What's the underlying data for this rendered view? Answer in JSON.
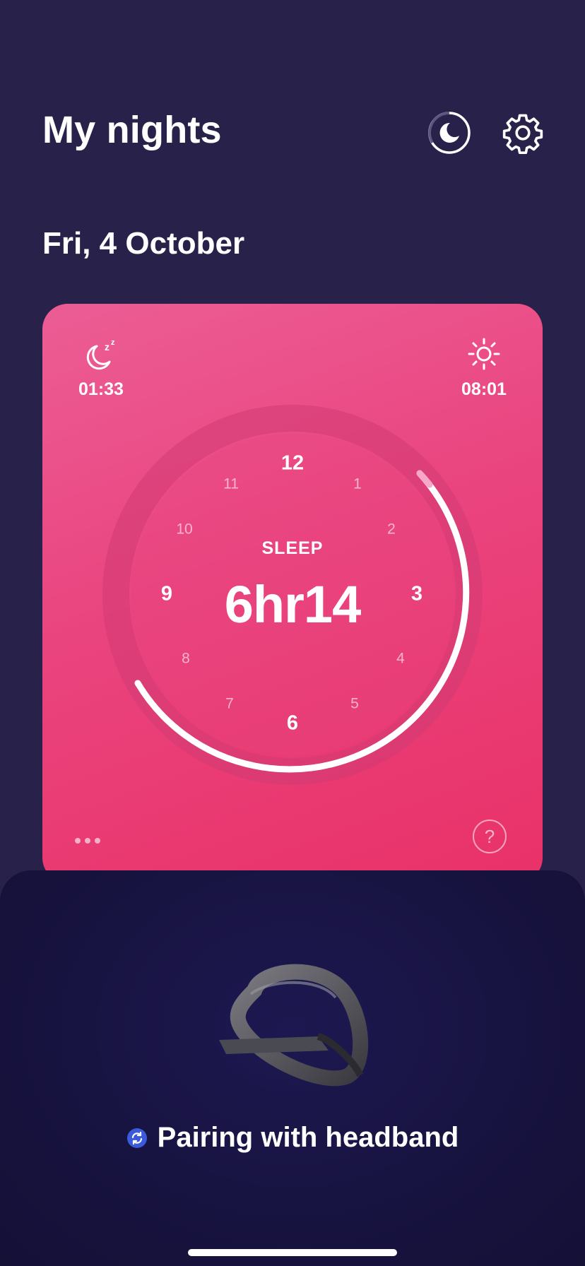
{
  "header": {
    "title": "My nights",
    "sleep_mode_icon": "moon-icon",
    "settings_icon": "gear-icon"
  },
  "date": "Fri, 4 October",
  "card": {
    "bedtime": {
      "icon": "moon-zzz-icon",
      "time": "01:33"
    },
    "wake": {
      "icon": "sun-icon",
      "time": "08:01"
    },
    "label": "SLEEP",
    "duration": "6hr14",
    "clock_numbers": [
      "12",
      "1",
      "2",
      "3",
      "4",
      "5",
      "6",
      "7",
      "8",
      "9",
      "10",
      "11"
    ],
    "more_icon": "more-dots-icon",
    "help_icon": "help-icon",
    "help_text": "?",
    "colors": {
      "card_start": "#ec5d95",
      "card_end": "#e93168",
      "arc": "#ffffff"
    }
  },
  "pairing": {
    "icon": "sync-icon",
    "text": "Pairing with headband",
    "accent": "#3b5bdb"
  }
}
